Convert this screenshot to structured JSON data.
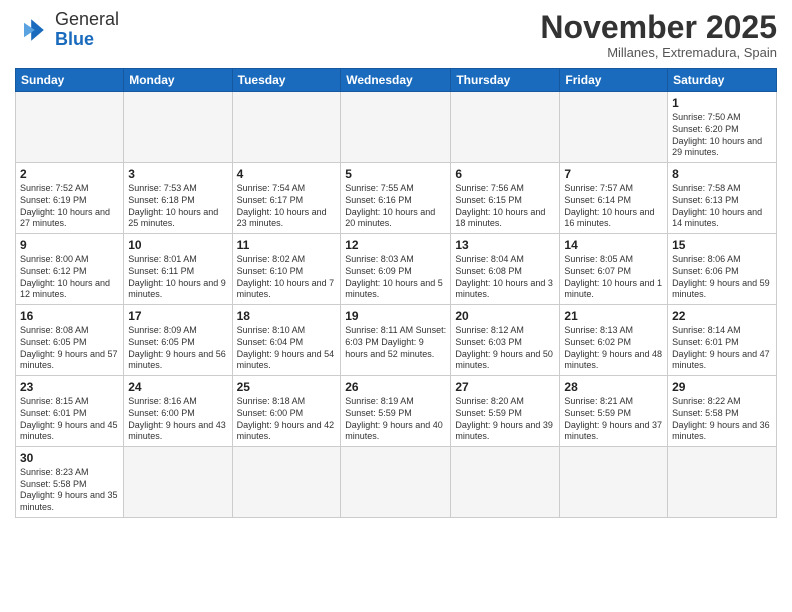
{
  "logo": {
    "line1": "General",
    "line2": "Blue"
  },
  "title": "November 2025",
  "subtitle": "Millanes, Extremadura, Spain",
  "weekdays": [
    "Sunday",
    "Monday",
    "Tuesday",
    "Wednesday",
    "Thursday",
    "Friday",
    "Saturday"
  ],
  "weeks": [
    [
      {
        "day": "",
        "info": ""
      },
      {
        "day": "",
        "info": ""
      },
      {
        "day": "",
        "info": ""
      },
      {
        "day": "",
        "info": ""
      },
      {
        "day": "",
        "info": ""
      },
      {
        "day": "",
        "info": ""
      },
      {
        "day": "1",
        "info": "Sunrise: 7:50 AM\nSunset: 6:20 PM\nDaylight: 10 hours and 29 minutes."
      }
    ],
    [
      {
        "day": "2",
        "info": "Sunrise: 7:52 AM\nSunset: 6:19 PM\nDaylight: 10 hours and 27 minutes."
      },
      {
        "day": "3",
        "info": "Sunrise: 7:53 AM\nSunset: 6:18 PM\nDaylight: 10 hours and 25 minutes."
      },
      {
        "day": "4",
        "info": "Sunrise: 7:54 AM\nSunset: 6:17 PM\nDaylight: 10 hours and 23 minutes."
      },
      {
        "day": "5",
        "info": "Sunrise: 7:55 AM\nSunset: 6:16 PM\nDaylight: 10 hours and 20 minutes."
      },
      {
        "day": "6",
        "info": "Sunrise: 7:56 AM\nSunset: 6:15 PM\nDaylight: 10 hours and 18 minutes."
      },
      {
        "day": "7",
        "info": "Sunrise: 7:57 AM\nSunset: 6:14 PM\nDaylight: 10 hours and 16 minutes."
      },
      {
        "day": "8",
        "info": "Sunrise: 7:58 AM\nSunset: 6:13 PM\nDaylight: 10 hours and 14 minutes."
      }
    ],
    [
      {
        "day": "9",
        "info": "Sunrise: 8:00 AM\nSunset: 6:12 PM\nDaylight: 10 hours and 12 minutes."
      },
      {
        "day": "10",
        "info": "Sunrise: 8:01 AM\nSunset: 6:11 PM\nDaylight: 10 hours and 9 minutes."
      },
      {
        "day": "11",
        "info": "Sunrise: 8:02 AM\nSunset: 6:10 PM\nDaylight: 10 hours and 7 minutes."
      },
      {
        "day": "12",
        "info": "Sunrise: 8:03 AM\nSunset: 6:09 PM\nDaylight: 10 hours and 5 minutes."
      },
      {
        "day": "13",
        "info": "Sunrise: 8:04 AM\nSunset: 6:08 PM\nDaylight: 10 hours and 3 minutes."
      },
      {
        "day": "14",
        "info": "Sunrise: 8:05 AM\nSunset: 6:07 PM\nDaylight: 10 hours and 1 minute."
      },
      {
        "day": "15",
        "info": "Sunrise: 8:06 AM\nSunset: 6:06 PM\nDaylight: 9 hours and 59 minutes."
      }
    ],
    [
      {
        "day": "16",
        "info": "Sunrise: 8:08 AM\nSunset: 6:05 PM\nDaylight: 9 hours and 57 minutes."
      },
      {
        "day": "17",
        "info": "Sunrise: 8:09 AM\nSunset: 6:05 PM\nDaylight: 9 hours and 56 minutes."
      },
      {
        "day": "18",
        "info": "Sunrise: 8:10 AM\nSunset: 6:04 PM\nDaylight: 9 hours and 54 minutes."
      },
      {
        "day": "19",
        "info": "Sunrise: 8:11 AM\nSunset: 6:03 PM\nDaylight: 9 hours and 52 minutes."
      },
      {
        "day": "20",
        "info": "Sunrise: 8:12 AM\nSunset: 6:03 PM\nDaylight: 9 hours and 50 minutes."
      },
      {
        "day": "21",
        "info": "Sunrise: 8:13 AM\nSunset: 6:02 PM\nDaylight: 9 hours and 48 minutes."
      },
      {
        "day": "22",
        "info": "Sunrise: 8:14 AM\nSunset: 6:01 PM\nDaylight: 9 hours and 47 minutes."
      }
    ],
    [
      {
        "day": "23",
        "info": "Sunrise: 8:15 AM\nSunset: 6:01 PM\nDaylight: 9 hours and 45 minutes."
      },
      {
        "day": "24",
        "info": "Sunrise: 8:16 AM\nSunset: 6:00 PM\nDaylight: 9 hours and 43 minutes."
      },
      {
        "day": "25",
        "info": "Sunrise: 8:18 AM\nSunset: 6:00 PM\nDaylight: 9 hours and 42 minutes."
      },
      {
        "day": "26",
        "info": "Sunrise: 8:19 AM\nSunset: 5:59 PM\nDaylight: 9 hours and 40 minutes."
      },
      {
        "day": "27",
        "info": "Sunrise: 8:20 AM\nSunset: 5:59 PM\nDaylight: 9 hours and 39 minutes."
      },
      {
        "day": "28",
        "info": "Sunrise: 8:21 AM\nSunset: 5:59 PM\nDaylight: 9 hours and 37 minutes."
      },
      {
        "day": "29",
        "info": "Sunrise: 8:22 AM\nSunset: 5:58 PM\nDaylight: 9 hours and 36 minutes."
      }
    ],
    [
      {
        "day": "30",
        "info": "Sunrise: 8:23 AM\nSunset: 5:58 PM\nDaylight: 9 hours and 35 minutes."
      },
      {
        "day": "",
        "info": ""
      },
      {
        "day": "",
        "info": ""
      },
      {
        "day": "",
        "info": ""
      },
      {
        "day": "",
        "info": ""
      },
      {
        "day": "",
        "info": ""
      },
      {
        "day": "",
        "info": ""
      }
    ]
  ]
}
